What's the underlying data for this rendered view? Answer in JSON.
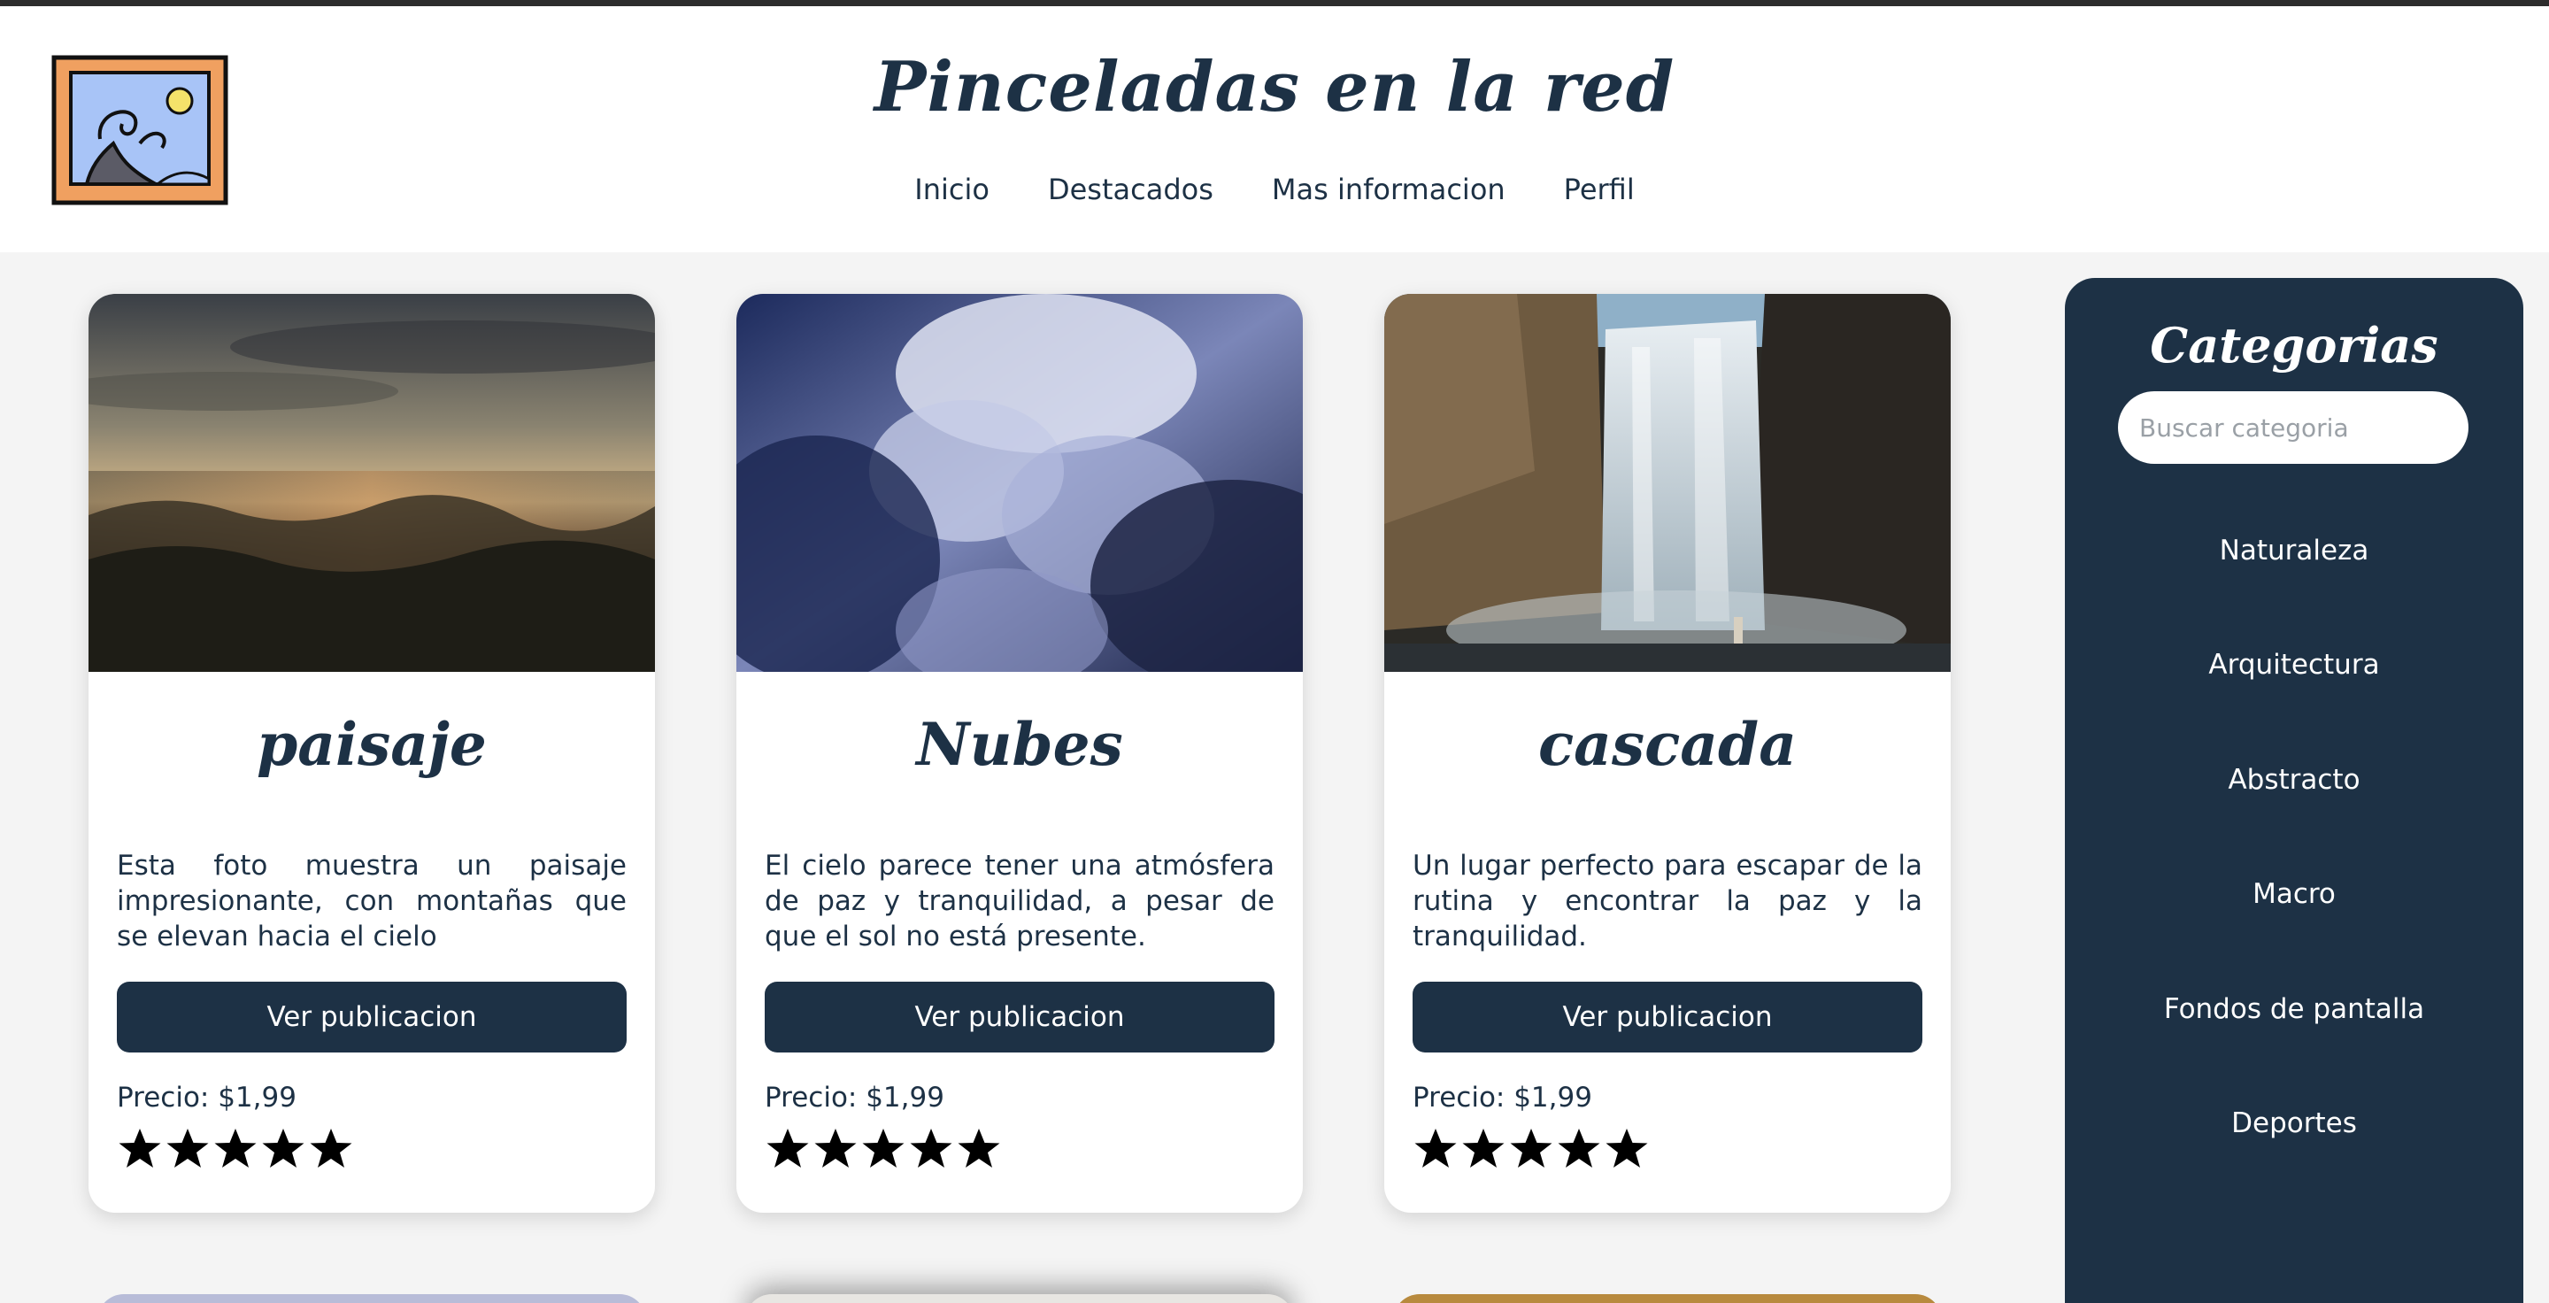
{
  "header": {
    "title": "Pinceladas en la red",
    "nav": [
      "Inicio",
      "Destacados",
      "Mas informacion",
      "Perfil"
    ]
  },
  "cards": [
    {
      "title": "paisaje",
      "description": "Esta foto muestra un paisaje impresionante, con montañas que se elevan hacia el cielo",
      "button": "Ver publicacion",
      "price": "Precio: $1,99",
      "rating": 5
    },
    {
      "title": "Nubes",
      "description": "El cielo parece tener una atmósfera de paz y tranquilidad, a pesar de que el sol no está presente.",
      "button": "Ver publicacion",
      "price": "Precio: $1,99",
      "rating": 5
    },
    {
      "title": "cascada",
      "description": "Un lugar perfecto para escapar de la rutina y encontrar la paz y la tranquilidad.",
      "button": "Ver publicacion",
      "price": "Precio: $1,99",
      "rating": 5
    }
  ],
  "sidebar": {
    "title": "Categorias",
    "search_placeholder": "Buscar categoria",
    "categories": [
      "Naturaleza",
      "Arquitectura",
      "Abstracto",
      "Macro",
      "Fondos de pantalla",
      "Deportes"
    ]
  },
  "colors": {
    "primary": "#1d3145",
    "background": "#f4f4f4",
    "star": "#000000"
  }
}
